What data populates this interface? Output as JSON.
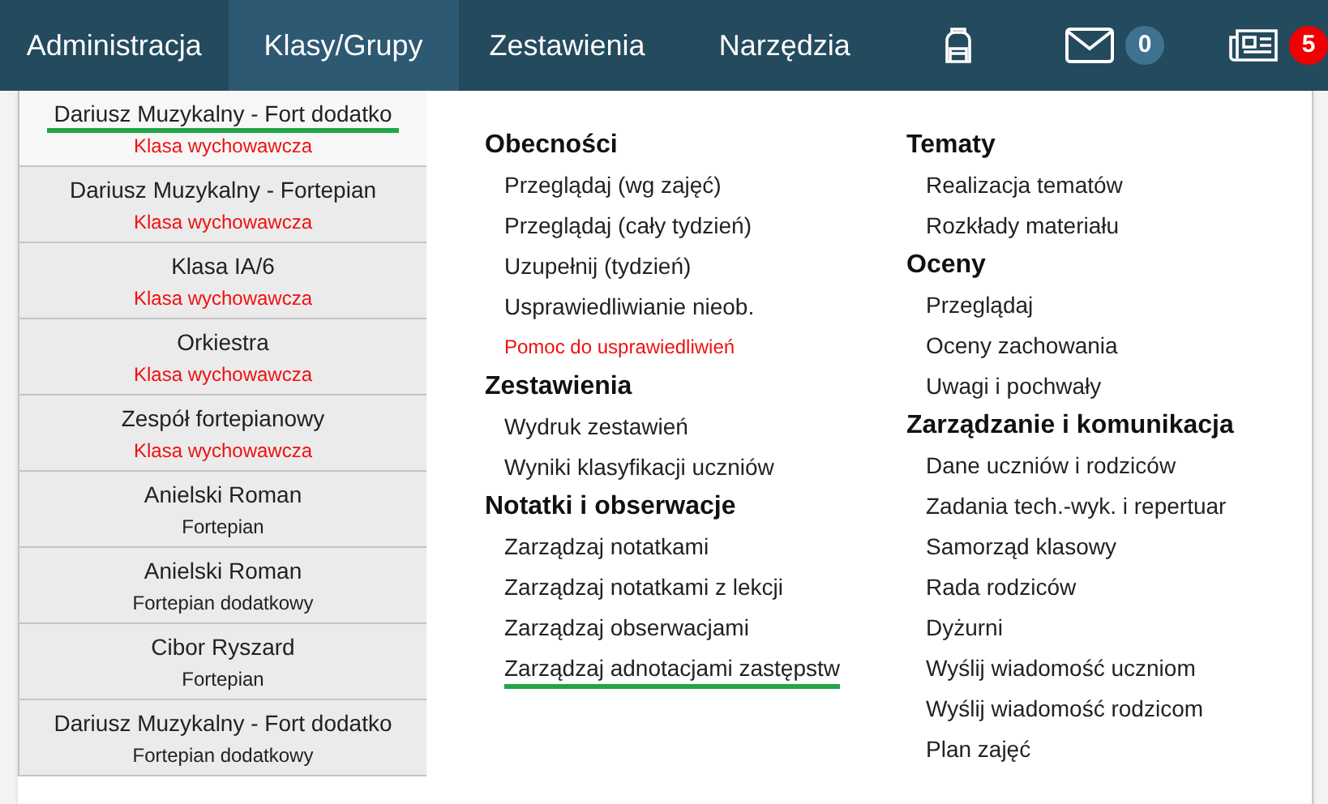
{
  "nav": {
    "tabs": [
      {
        "label": "Administracja",
        "selected": false
      },
      {
        "label": "Klasy/Grupy",
        "selected": true
      },
      {
        "label": "Zestawienia",
        "selected": false
      },
      {
        "label": "Narzędzia",
        "selected": false
      }
    ],
    "icons": [
      {
        "kind": "backpack"
      },
      {
        "kind": "mail",
        "badge": "0"
      },
      {
        "kind": "news",
        "badge": "5"
      }
    ]
  },
  "groups": [
    {
      "name": "Dariusz Muzykalny - Fort dodatko",
      "subtitle": "Klasa wychowawcza",
      "kind": "homeroom",
      "selected": true
    },
    {
      "name": "Dariusz Muzykalny - Fortepian",
      "subtitle": "Klasa wychowawcza",
      "kind": "homeroom",
      "selected": false
    },
    {
      "name": "Klasa IA/6",
      "subtitle": "Klasa wychowawcza",
      "kind": "homeroom",
      "selected": false
    },
    {
      "name": "Orkiestra",
      "subtitle": "Klasa wychowawcza",
      "kind": "homeroom",
      "selected": false
    },
    {
      "name": "Zespół fortepianowy",
      "subtitle": "Klasa wychowawcza",
      "kind": "homeroom",
      "selected": false
    },
    {
      "name": "Anielski Roman",
      "subtitle": "Fortepian",
      "kind": "subject",
      "selected": false
    },
    {
      "name": "Anielski Roman",
      "subtitle": "Fortepian dodatkowy",
      "kind": "subject",
      "selected": false
    },
    {
      "name": "Cibor Ryszard",
      "subtitle": "Fortepian",
      "kind": "subject",
      "selected": false
    },
    {
      "name": "Dariusz Muzykalny - Fort dodatko",
      "subtitle": "Fortepian dodatkowy",
      "kind": "subject",
      "selected": false
    }
  ],
  "menu_columns": [
    [
      {
        "heading": "Obecności",
        "items": [
          {
            "label": "Przeglądaj (wg zajęć)",
            "kind": "link",
            "underlined": false
          },
          {
            "label": "Przeglądaj (cały tydzień)",
            "kind": "link",
            "underlined": false
          },
          {
            "label": "Uzupełnij (tydzień)",
            "kind": "link",
            "underlined": false
          },
          {
            "label": "Usprawiedliwianie nieob.",
            "kind": "link",
            "underlined": false
          },
          {
            "label": "Pomoc do usprawiedliwień",
            "kind": "help",
            "underlined": false
          }
        ]
      },
      {
        "heading": "Zestawienia",
        "items": [
          {
            "label": "Wydruk zestawień",
            "kind": "link",
            "underlined": false
          },
          {
            "label": "Wyniki klasyfikacji uczniów",
            "kind": "link",
            "underlined": false
          }
        ]
      },
      {
        "heading": "Notatki i obserwacje",
        "items": [
          {
            "label": "Zarządzaj notatkami",
            "kind": "link",
            "underlined": false
          },
          {
            "label": "Zarządzaj notatkami z lekcji",
            "kind": "link",
            "underlined": false
          },
          {
            "label": "Zarządzaj obserwacjami",
            "kind": "link",
            "underlined": false
          },
          {
            "label": "Zarządzaj adnotacjami zastępstw",
            "kind": "link",
            "underlined": true
          }
        ]
      }
    ],
    [
      {
        "heading": "Tematy",
        "items": [
          {
            "label": "Realizacja tematów",
            "kind": "link",
            "underlined": false
          },
          {
            "label": "Rozkłady materiału",
            "kind": "link",
            "underlined": false
          }
        ]
      },
      {
        "heading": "Oceny",
        "items": [
          {
            "label": "Przeglądaj",
            "kind": "link",
            "underlined": false
          },
          {
            "label": "Oceny zachowania",
            "kind": "link",
            "underlined": false
          },
          {
            "label": "Uwagi i pochwały",
            "kind": "link",
            "underlined": false
          }
        ]
      },
      {
        "heading": "Zarządzanie i komunikacja",
        "items": [
          {
            "label": "Dane uczniów i rodziców",
            "kind": "link",
            "underlined": false
          },
          {
            "label": "Zadania tech.-wyk. i repertuar",
            "kind": "link",
            "underlined": false
          },
          {
            "label": "Samorząd klasowy",
            "kind": "link",
            "underlined": false
          },
          {
            "label": "Rada rodziców",
            "kind": "link",
            "underlined": false
          },
          {
            "label": "Dyżurni",
            "kind": "link",
            "underlined": false
          },
          {
            "label": "Wyślij wiadomość uczniom",
            "kind": "link",
            "underlined": false
          },
          {
            "label": "Wyślij wiadomość rodzicom",
            "kind": "link",
            "underlined": false
          },
          {
            "label": "Plan zajęć",
            "kind": "link",
            "underlined": false
          }
        ]
      }
    ]
  ]
}
